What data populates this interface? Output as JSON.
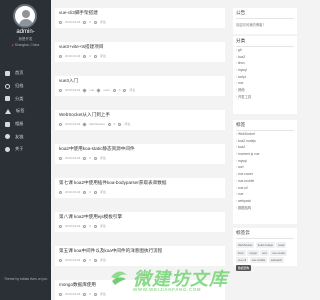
{
  "sidebar": {
    "author": "admin-",
    "subtitle": "我是开发",
    "location": "Shanghai, China",
    "nav": [
      {
        "label": "首页",
        "icon": "home-icon"
      },
      {
        "label": "归档",
        "icon": "archive-icon"
      },
      {
        "label": "分类",
        "icon": "folder-icon"
      },
      {
        "label": "标签",
        "icon": "tag-icon"
      },
      {
        "label": "相册",
        "icon": "image-icon"
      },
      {
        "label": "友链",
        "icon": "link-icon"
      },
      {
        "label": "关于",
        "icon": "user-icon"
      }
    ],
    "footer": "Theme by tobias lives on jun."
  },
  "posts": [
    {
      "title": "vue-cli3脚手架搭建",
      "date": "2019-03-03",
      "views": "0",
      "comments": "评论",
      "tags": []
    },
    {
      "title": "vue3+vite+ts搭建项目",
      "date": "2019-03-03",
      "views": "0",
      "comments": "评论",
      "tags": []
    },
    {
      "title": "vue3入门",
      "date": "2019-03-03",
      "views": "0",
      "comments": "评论",
      "tags": [
        "vue",
        "vue3"
      ]
    },
    {
      "title": "WebSocket从入门到上手",
      "date": "2019-03-03",
      "views": "0",
      "comments": "评论",
      "tags": [
        "WebSocket"
      ]
    },
    {
      "title": "koa2中使用koa-static静态资源中间件",
      "date": "2019-03-03",
      "views": "0",
      "comments": "评论",
      "tags": []
    },
    {
      "title": "第七课 koa2中使用插件koa-bodyparser获取表单数据",
      "date": "2019-03-03",
      "views": "0",
      "comments": "评论",
      "tags": []
    },
    {
      "title": "第八课 koa2中使用ejs模板引擎",
      "date": "2019-03-03",
      "views": "0",
      "comments": "评论",
      "tags": []
    },
    {
      "title": "第五课 koa中间件以及koa中间件的洋葱图执行流程",
      "date": "2019-03-03",
      "views": "0",
      "comments": "评论",
      "tags": []
    },
    {
      "title": "mongo数据库使用",
      "date": "2019-03-03",
      "views": "0",
      "comments": "评论",
      "tags": []
    }
  ],
  "right": {
    "notice_title": "公告",
    "notice_text": "欢迎访问我的博客！",
    "categories_title": "分类",
    "categories": [
      "git",
      "koa2",
      "linux",
      "mysql",
      "script",
      "vue",
      "其他",
      "开发工具"
    ],
    "tags_title": "标签",
    "tag_list": [
      "WebSocket",
      "koa2 nodejs",
      "koa2",
      "moment.js vue",
      "mysql",
      "sort",
      "vue-router",
      "vue-mobile",
      "vue-cli",
      "vue",
      "webpack",
      "数据结构"
    ],
    "cloud_title": "标签云",
    "cloud": [
      "WebSocket",
      "koa2 nodejs",
      "koa2",
      "linux",
      "mysql",
      "sort",
      "vue-router",
      "vue-cli",
      "vue-mobile",
      "webpack",
      "数据结构"
    ]
  },
  "watermark": {
    "cn": "微建坊文库",
    "en": "WWW.WEIJIANFANG.COM"
  }
}
